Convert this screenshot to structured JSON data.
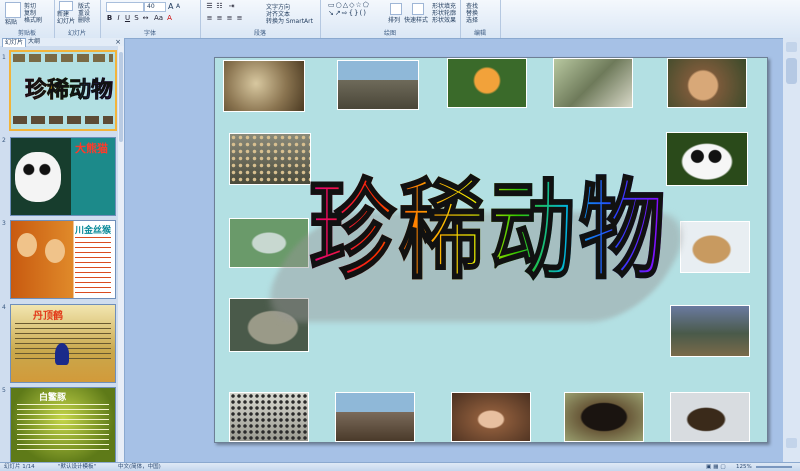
{
  "ribbon": {
    "clipboard": {
      "label": "剪贴板",
      "paste": "粘贴",
      "cut": "剪切",
      "copy": "复制",
      "format_painter": "格式刷"
    },
    "slides": {
      "label": "幻灯片",
      "new_slide": "新建\n幻灯片",
      "layout": "版式",
      "reset": "重设",
      "delete": "删除"
    },
    "font": {
      "label": "字体",
      "size": "40"
    },
    "paragraph": {
      "label": "段落",
      "text_direction": "文字方向",
      "align_text": "对齐文本",
      "smartart": "转换为 SmartArt"
    },
    "drawing": {
      "label": "绘图",
      "arrange": "排列",
      "quick_styles": "快速样式",
      "shape_fill": "形状填充",
      "shape_outline": "形状轮廓",
      "shape_effects": "形状效果"
    },
    "editing": {
      "label": "编辑",
      "find": "查找",
      "replace": "替换",
      "select": "选择"
    }
  },
  "pane": {
    "tab_slides": "幻灯片",
    "tab_outline": "大纲",
    "close": "×",
    "slides": [
      {
        "num": "1",
        "title": "珍稀动物"
      },
      {
        "num": "2",
        "title": "大熊猫"
      },
      {
        "num": "3",
        "title": "川金丝猴"
      },
      {
        "num": "4",
        "title": "丹顶鹤"
      },
      {
        "num": "5",
        "title": "白鳘豚"
      }
    ]
  },
  "slide": {
    "title": "珍稀动物",
    "photos": [
      "manul",
      "elephant",
      "lemur",
      "monkeys",
      "macaque",
      "leopard",
      "panda",
      "dolphin",
      "lynx",
      "seal",
      "goats",
      "snow-leopard",
      "elephant-2",
      "ape",
      "bear",
      "sea-lion"
    ]
  },
  "status": {
    "slide_info": "幻灯片 1/14",
    "theme": "\"默认设计模板\"",
    "language": "中文(简体，中国)",
    "zoom": "125%"
  },
  "colors": {
    "ribbon": "#dbe7f5",
    "workspace": "#a6c1e6",
    "slide_bg": "#b3e0e3",
    "selected_thumb": "#f2b43a"
  }
}
